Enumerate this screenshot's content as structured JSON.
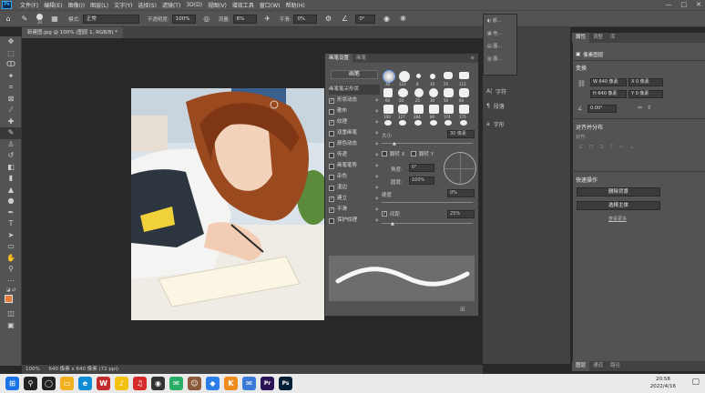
{
  "menubar": {
    "logo": "Ps",
    "items": [
      "文件(F)",
      "编辑(E)",
      "图像(I)",
      "图层(L)",
      "文字(Y)",
      "选择(S)",
      "滤镜(T)",
      "3D(D)",
      "视图(V)",
      "增效工具",
      "窗口(W)",
      "帮助(H)"
    ],
    "window_buttons": [
      "—",
      "□",
      "✕"
    ]
  },
  "options": {
    "brush_size": "30",
    "mode_label": "模式:",
    "mode_value": "正常",
    "opacity_label": "不透明度:",
    "opacity_value": "100%",
    "flow_label": "流量:",
    "flow_value": "6%",
    "smoothing_label": "平滑:",
    "smoothing_value": "0%",
    "angle_value": "0°"
  },
  "document": {
    "tab_title": "新建图.jpg @ 100% (图层 1, RGB/8) *",
    "zoom": "100%",
    "status": "640 像素 x 640 像素 (72 ppi)"
  },
  "brush_panel": {
    "tabs": [
      "画笔设置",
      "画笔"
    ],
    "brushes_button": "画笔",
    "items": [
      {
        "label": "画笔笔尖形状",
        "checked": false,
        "header": true
      },
      {
        "label": "形状动态",
        "checked": true
      },
      {
        "label": "散布",
        "checked": false
      },
      {
        "label": "纹理",
        "checked": true
      },
      {
        "label": "双重画笔",
        "checked": false
      },
      {
        "label": "颜色动态",
        "checked": false
      },
      {
        "label": "传递",
        "checked": false
      },
      {
        "label": "画笔笔势",
        "checked": false
      },
      {
        "label": "杂色",
        "checked": false
      },
      {
        "label": "湿边",
        "checked": false
      },
      {
        "label": "建立",
        "checked": true
      },
      {
        "label": "平滑",
        "checked": true
      },
      {
        "label": "保护纹理",
        "checked": false
      }
    ],
    "tip_sizes": [
      "30",
      "123",
      "8",
      "10",
      "25",
      "112",
      "60",
      "50",
      "25",
      "30",
      "50",
      "60",
      "100",
      "127",
      "284",
      "80",
      "174",
      "175",
      "306",
      "50",
      "16",
      "25",
      "20",
      "20"
    ],
    "size_label": "大小",
    "size_value": "30 像素",
    "flip_x": "翻转 X",
    "flip_y": "翻转 Y",
    "angle_label": "角度:",
    "angle_value": "0°",
    "roundness_label": "圆度:",
    "roundness_value": "100%",
    "hardness_label": "硬度",
    "hardness_value": "0%",
    "spacing_label": "间距",
    "spacing_value": "25%"
  },
  "mini_panel": {
    "items": [
      "颜...",
      "色...",
      "图...",
      "图..."
    ]
  },
  "right_dock": {
    "items": [
      "字符",
      "段落",
      "字形"
    ]
  },
  "properties": {
    "tabs": [
      "属性",
      "调整",
      "库"
    ],
    "layer_type": "像素图层",
    "transform_title": "变换",
    "w_label": "W",
    "w_value": "640 像素",
    "h_label": "H",
    "h_value": "640 像素",
    "x_label": "X",
    "x_value": "0 像素",
    "y_label": "Y",
    "y_value": "0 像素",
    "angle_value": "0.00°",
    "align_title": "对齐并分布",
    "align_sub": "对齐:",
    "quick_title": "快速操作",
    "quick_buttons": [
      "删除背景",
      "选择主体"
    ],
    "more_link": "查看更多"
  },
  "layers_panel": {
    "tabs": [
      "图层",
      "通道",
      "路径"
    ]
  },
  "taskbar": {
    "time": "20:58",
    "date": "2022/4/16",
    "apps": [
      {
        "icon": "start-icon",
        "color": "#1a73e8"
      },
      {
        "icon": "search-icon",
        "color": "#222222"
      },
      {
        "icon": "task-view-icon",
        "color": "#222222"
      },
      {
        "icon": "explorer-icon",
        "color": "#f2b01e"
      },
      {
        "icon": "edge-icon",
        "color": "#0f8bd6"
      },
      {
        "icon": "wps-icon",
        "color": "#c22b2b"
      },
      {
        "icon": "qq-music-icon",
        "color": "#f4c10f"
      },
      {
        "icon": "netease-icon",
        "color": "#d62b2b"
      },
      {
        "icon": "media-icon",
        "color": "#333333"
      },
      {
        "icon": "wechat-icon",
        "color": "#2aae67"
      },
      {
        "icon": "photo-icon",
        "color": "#8a5a3a"
      },
      {
        "icon": "feishu-icon",
        "color": "#2b7de9"
      },
      {
        "icon": "kugou-icon",
        "color": "#f08b1e"
      },
      {
        "icon": "mail-icon",
        "color": "#3b7bd8"
      },
      {
        "icon": "premiere-icon",
        "color": "#2a1457"
      },
      {
        "icon": "photoshop-icon",
        "color": "#001e36"
      }
    ]
  }
}
